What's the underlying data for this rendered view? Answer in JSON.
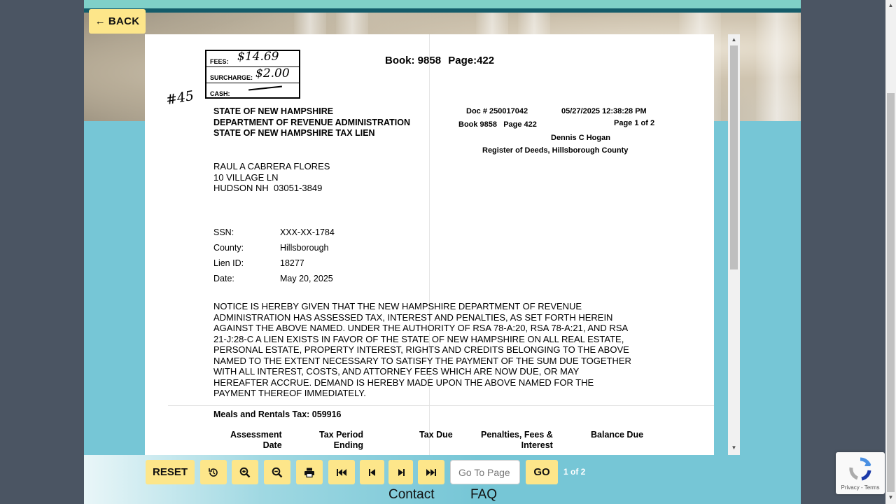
{
  "nav": {
    "back_label": "BACK",
    "back_icon": "arrow-left-icon"
  },
  "document": {
    "book_label": "Book:",
    "book_value": "9858",
    "page_label": "Page:",
    "page_value": "422",
    "stamp": {
      "fees_label": "FEES:",
      "fees_value": "$14.69",
      "surcharge_label": "SURCHARGE:",
      "surcharge_value": "$2.00",
      "cash_label": "CASH:",
      "margin_note": "#45"
    },
    "agency": {
      "line1": "STATE OF NEW HAMPSHIRE",
      "line2": "DEPARTMENT OF REVENUE ADMINISTRATION",
      "line3": "STATE OF NEW HAMPSHIRE TAX LIEN"
    },
    "recording": {
      "doc_number": "Doc # 250017042",
      "datetime": "05/27/2025 12:38:28 PM",
      "book_page": "Book 9858   Page 422",
      "page_of": "Page 1 of 2",
      "register_name": "Dennis C Hogan",
      "register_title": "Register of Deeds, Hillsborough County"
    },
    "addressee": {
      "name": "RAUL A CABRERA FLORES",
      "street": "10 VILLAGE LN",
      "city": "HUDSON NH  03051-3849"
    },
    "fields": [
      {
        "label": "SSN:",
        "value": "XXX-XX-1784"
      },
      {
        "label": "County:",
        "value": "Hillsborough"
      },
      {
        "label": "Lien ID:",
        "value": "18277"
      },
      {
        "label": "Date:",
        "value": "May 20, 2025"
      }
    ],
    "notice_lines": [
      "NOTICE IS HEREBY GIVEN THAT THE NEW HAMPSHIRE DEPARTMENT OF REVENUE",
      "ADMINISTRATION HAS ASSESSED TAX, INTEREST AND PENALTIES, AS SET FORTH HEREIN",
      "AGAINST THE ABOVE NAMED. UNDER THE AUTHORITY OF RSA 78-A:20, RSA 78-A:21, AND RSA",
      "21-J:28-C A LIEN EXISTS IN FAVOR OF THE STATE OF NEW HAMPSHIRE ON ALL REAL ESTATE,",
      "PERSONAL ESTATE, PROPERTY INTEREST, RIGHTS AND CREDITS BELONGING TO THE ABOVE",
      "NAMED TO THE EXTENT NECESSARY TO SATISFY THE PAYMENT OF THE SUM DUE TOGETHER",
      "WITH ALL INTEREST, COSTS, AND ATTORNEY FEES WHICH ARE NOW DUE, OR MAY",
      "HEREAFTER ACCRUE. DEMAND IS HEREBY MADE UPON THE ABOVE NAMED FOR THE",
      "PAYMENT THEREOF IMMEDIATELY."
    ],
    "tax_type": "Meals and Rentals Tax: 059916",
    "table_headers": {
      "assessment_date": [
        "Assessment",
        "Date"
      ],
      "tax_period": [
        "Tax Period",
        "Ending"
      ],
      "tax_due": "Tax Due",
      "penalties": [
        "Penalties, Fees &",
        "Interest"
      ],
      "balance_due": "Balance Due"
    }
  },
  "toolbar": {
    "reset_label": "RESET",
    "icons": [
      "rotate-icon",
      "zoom-in-icon",
      "zoom-out-icon",
      "print-icon",
      "first-page-icon",
      "prev-page-icon",
      "next-page-icon",
      "last-page-icon"
    ],
    "goto_placeholder": "Go To Page",
    "go_label": "GO",
    "page_count": "1 of 2"
  },
  "footer": {
    "contact": "Contact",
    "faq": "FAQ"
  },
  "recaptcha": {
    "privacy": "Privacy",
    "terms": "Terms",
    "separator": " - "
  },
  "colors": {
    "button": "#fde68a",
    "panel": "#76c6d6",
    "header_bar": "#145c6a"
  }
}
